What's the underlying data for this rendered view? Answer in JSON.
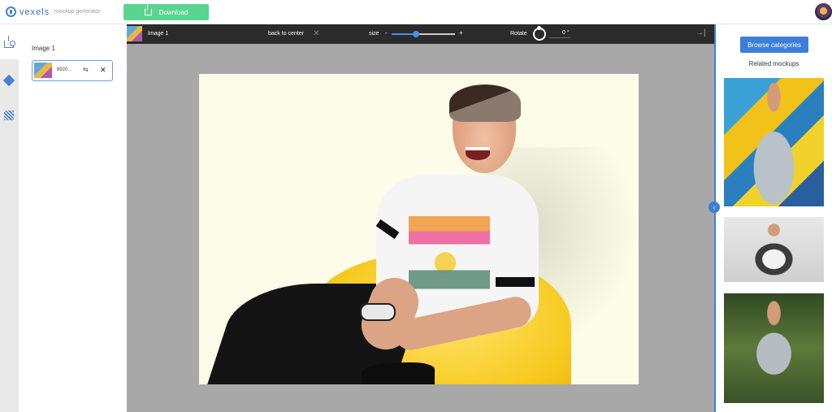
{
  "header": {
    "logo_text": "vexels",
    "logo_sub": "mockup generator",
    "download_label": "Download"
  },
  "rail": {
    "tools": [
      "upload-icon",
      "paint-bucket-icon",
      "pattern-icon"
    ]
  },
  "layers": {
    "title": "Image 1",
    "items": [
      {
        "name": "8920..."
      }
    ]
  },
  "toolbar": {
    "image_name": "Image 1",
    "back_to_center": "back to center",
    "size_label": "size",
    "size_minus": "-",
    "size_plus": "+",
    "size_value": 0.38,
    "rotate_label": "Rotate",
    "rotate_value": "0 °"
  },
  "drawer": {
    "browse_label": "Browse categories",
    "related_title": "Related mockups"
  },
  "colors": {
    "accent": "#3c7ed9",
    "download": "#5ad58f",
    "toolbar_bg": "#2b2b2b",
    "canvas_bg": "#a8a8a8",
    "artboard_bg": "#fdfce9"
  }
}
